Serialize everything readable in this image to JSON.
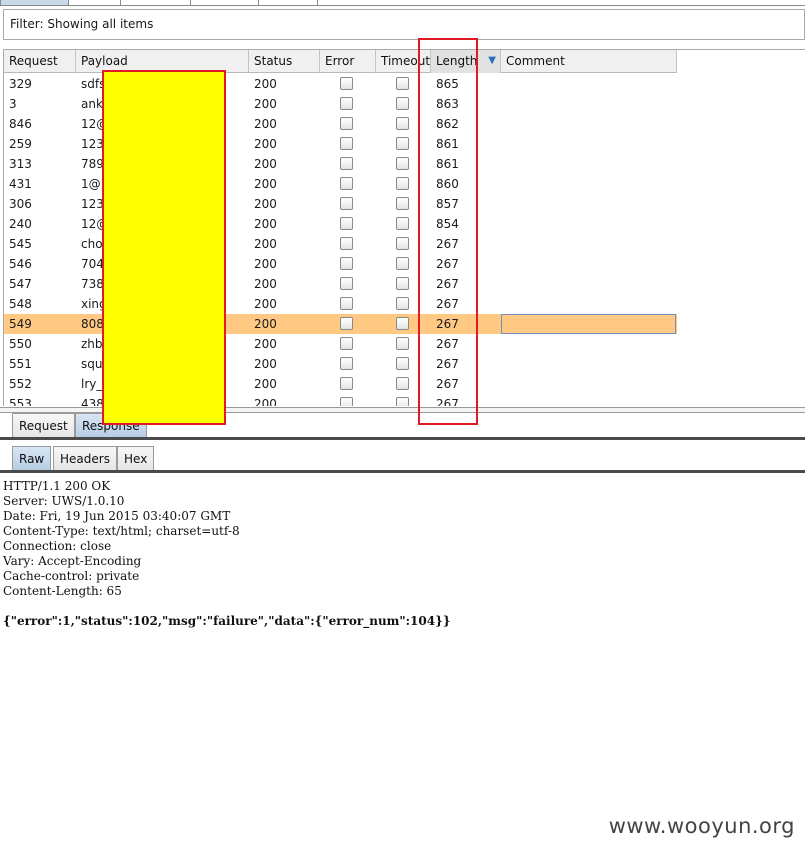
{
  "filter": {
    "text": "Filter: Showing all items"
  },
  "table": {
    "columns": [
      "Request",
      "Payload",
      "Status",
      "Error",
      "Timeout",
      "Length",
      "Comment"
    ],
    "sorted_column": "Length",
    "rows": [
      {
        "request": "329",
        "payload": "sdfs",
        "status": "200",
        "length": "865"
      },
      {
        "request": "3",
        "payload": "anky",
        "status": "200",
        "length": "863"
      },
      {
        "request": "846",
        "payload": "12@",
        "status": "200",
        "length": "862"
      },
      {
        "request": "259",
        "payload": "1234",
        "status": "200",
        "length": "861"
      },
      {
        "request": "313",
        "payload": "789",
        "status": "200",
        "length": "861"
      },
      {
        "request": "431",
        "payload": "1@1",
        "status": "200",
        "length": "860"
      },
      {
        "request": "306",
        "payload": "123",
        "status": "200",
        "length": "857"
      },
      {
        "request": "240",
        "payload": "12@",
        "status": "200",
        "length": "854"
      },
      {
        "request": "545",
        "payload": "cho",
        "status": "200",
        "length": "267"
      },
      {
        "request": "546",
        "payload": "704",
        "status": "200",
        "length": "267"
      },
      {
        "request": "547",
        "payload": "738",
        "status": "200",
        "length": "267"
      },
      {
        "request": "548",
        "payload": "xing",
        "status": "200",
        "length": "267"
      },
      {
        "request": "549",
        "payload": "808",
        "status": "200",
        "length": "267",
        "selected": true
      },
      {
        "request": "550",
        "payload": "zhb8",
        "status": "200",
        "length": "267"
      },
      {
        "request": "551",
        "payload": "squi",
        "status": "200",
        "length": "267"
      },
      {
        "request": "552",
        "payload": "lry_1",
        "status": "200",
        "length": "267"
      },
      {
        "request": "553",
        "payload": "438",
        "status": "200",
        "length": "267"
      }
    ]
  },
  "message_tabs": [
    "Request",
    "Response"
  ],
  "message_tabs_active": "Response",
  "view_tabs": [
    "Raw",
    "Headers",
    "Hex"
  ],
  "view_tabs_active": "Raw",
  "response": {
    "lines": [
      "HTTP/1.1 200 OK",
      "Server: UWS/1.0.10",
      "Date: Fri, 19 Jun 2015 03:40:07 GMT",
      "Content-Type: text/html; charset=utf-8",
      "Connection: close",
      "Vary: Accept-Encoding",
      "Cache-control: private",
      "Content-Length: 65",
      "",
      "{\"error\":1,\"status\":102,\"msg\":\"failure\",\"data\":{\"error_num\":104}}"
    ]
  },
  "watermark": "www.wooyun.org",
  "colors": {
    "selected_row": "#ffc984",
    "redaction": "#ffff00",
    "highlight_border": "#e01b24",
    "active_tab": "#c4d7ea"
  }
}
